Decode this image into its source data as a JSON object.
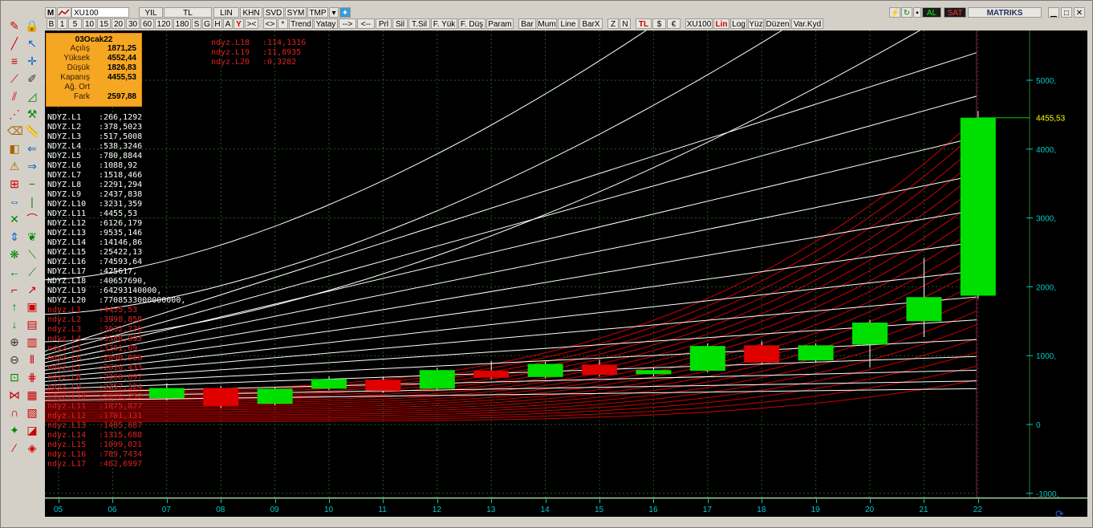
{
  "toolbar_top": {
    "m_label": "M",
    "symbol": "XU100",
    "periods": [
      "YIL",
      "TL",
      "LIN",
      "KHN",
      "SVD",
      "SYM",
      "TMP"
    ],
    "right": {
      "al": "AL",
      "sat": "SAT",
      "brand": "MATRIKS"
    }
  },
  "toolbar_bottom": {
    "buttons": [
      "B",
      "1",
      "5",
      "10",
      "15",
      "20",
      "30",
      "60",
      "120",
      "180",
      "S",
      "G",
      "H",
      "A",
      "Y",
      "><",
      "<>",
      "*",
      "Trend",
      "Yatay",
      "-->",
      "<--",
      "Prl",
      "Sil",
      "T.Sil",
      "F. Yük",
      "F. Düş",
      "Param",
      "Bar",
      "Mum",
      "Line",
      "BarX",
      "Z",
      "N",
      "TL",
      "$",
      "€",
      "XU100",
      "Lin",
      "Log",
      "Yüz",
      "Düzen",
      "Var.Kyd"
    ]
  },
  "infobox": {
    "date": "03Ocak22",
    "rows": [
      {
        "k": "Açılış",
        "v": "1871,25"
      },
      {
        "k": "Yüksek",
        "v": "4552,44"
      },
      {
        "k": "Düşük",
        "v": "1826,83"
      },
      {
        "k": "Kapanış",
        "v": "4455,53"
      },
      {
        "k": "Ağ. Ort",
        "v": ""
      },
      {
        "k": "Fark",
        "v": "2597,88"
      }
    ]
  },
  "top_series": [
    {
      "name": "ndyz.L18",
      "value": ":114,1316"
    },
    {
      "name": "ndyz.L19",
      "value": ":11,8935"
    },
    {
      "name": "ndyz.L20",
      "value": ":0,3282"
    }
  ],
  "white_series": [
    {
      "name": "NDYZ.L1",
      "value": ":266,1292"
    },
    {
      "name": "NDYZ.L2",
      "value": ":378,5023"
    },
    {
      "name": "NDYZ.L3",
      "value": ":517,5008"
    },
    {
      "name": "NDYZ.L4",
      "value": ":538,3246"
    },
    {
      "name": "NDYZ.L5",
      "value": ":780,8844"
    },
    {
      "name": "NDYZ.L6",
      "value": ":1088,92"
    },
    {
      "name": "NDYZ.L7",
      "value": ":1518,466"
    },
    {
      "name": "NDYZ.L8",
      "value": ":2291,294"
    },
    {
      "name": "NDYZ.L9",
      "value": ":2437,838"
    },
    {
      "name": "NDYZ.L10",
      "value": ":3231,359"
    },
    {
      "name": "NDYZ.L11",
      "value": ":4455,53"
    },
    {
      "name": "NDYZ.L12",
      "value": ":6126,179"
    },
    {
      "name": "NDYZ.L13",
      "value": ":9535,146"
    },
    {
      "name": "NDYZ.L14",
      "value": ":14146,86"
    },
    {
      "name": "NDYZ.L15",
      "value": ":25422,13"
    },
    {
      "name": "NDYZ.L16",
      "value": ":74593,64"
    },
    {
      "name": "NDYZ.L17",
      "value": ":425617,"
    },
    {
      "name": "NDYZ.L18",
      "value": ":40657690,"
    },
    {
      "name": "NDYZ.L19",
      "value": ":64293140000,"
    },
    {
      "name": "NDYZ.L20",
      "value": ":7708533000000000,"
    }
  ],
  "red_series": [
    {
      "name": "ndyz.L1",
      "value": ":4455,53"
    },
    {
      "name": "ndyz.L2",
      "value": ":3998,858"
    },
    {
      "name": "ndyz.L3",
      "value": ":3632,726"
    },
    {
      "name": "ndyz.L4",
      "value": ":3588,993"
    },
    {
      "name": "ndyz.L5",
      "value": ":3201,69"
    },
    {
      "name": "ndyz.L6",
      "value": ":2890,986"
    },
    {
      "name": "ndyz.L7",
      "value": ":2610,433"
    },
    {
      "name": "ndyz.L8",
      "value": ":2300,697"
    },
    {
      "name": "ndyz.L9",
      "value": ":2257,324"
    },
    {
      "name": "ndyz.L10",
      "value": ":2070,252"
    },
    {
      "name": "ndyz.L11",
      "value": ":1875,827"
    },
    {
      "name": "ndyz.L12",
      "value": ":1701,131"
    },
    {
      "name": "ndyz.L13",
      "value": ":1485,087"
    },
    {
      "name": "ndyz.L14",
      "value": ":1315,688"
    },
    {
      "name": "ndyz.L15",
      "value": ":1099,021"
    },
    {
      "name": "ndyz.L16",
      "value": ":789,7434"
    },
    {
      "name": "ndyz.L17",
      "value": ":462,6997"
    }
  ],
  "chart_data": {
    "type": "candlestick",
    "x_labels": [
      "05",
      "06",
      "07",
      "08",
      "09",
      "10",
      "11",
      "12",
      "13",
      "14",
      "15",
      "16",
      "17",
      "18",
      "19",
      "20",
      "21",
      "22"
    ],
    "y_ticks": [
      "5000,",
      "4000,",
      "3000,",
      "2000,",
      "1000,",
      "0",
      "-1000,"
    ],
    "y_tick_values": [
      5000,
      4000,
      3000,
      2000,
      1000,
      0,
      -1000
    ],
    "ylim": [
      -1000,
      5600
    ],
    "last_price_label": "4455,53",
    "last_price": 4455.53,
    "candles": [
      {
        "x": "07",
        "open": 380,
        "close": 530,
        "high": 600,
        "low": 350
      },
      {
        "x": "08",
        "open": 530,
        "close": 270,
        "high": 560,
        "low": 240
      },
      {
        "x": "09",
        "open": 300,
        "close": 520,
        "high": 540,
        "low": 280
      },
      {
        "x": "10",
        "open": 520,
        "close": 660,
        "high": 700,
        "low": 500
      },
      {
        "x": "11",
        "open": 650,
        "close": 490,
        "high": 690,
        "low": 460
      },
      {
        "x": "12",
        "open": 520,
        "close": 790,
        "high": 820,
        "low": 500
      },
      {
        "x": "13",
        "open": 780,
        "close": 680,
        "high": 920,
        "low": 660
      },
      {
        "x": "14",
        "open": 690,
        "close": 880,
        "high": 910,
        "low": 670
      },
      {
        "x": "15",
        "open": 870,
        "close": 720,
        "high": 940,
        "low": 700
      },
      {
        "x": "16",
        "open": 730,
        "close": 790,
        "high": 820,
        "low": 700
      },
      {
        "x": "17",
        "open": 780,
        "close": 1140,
        "high": 1180,
        "low": 760
      },
      {
        "x": "18",
        "open": 1150,
        "close": 900,
        "high": 1210,
        "low": 880
      },
      {
        "x": "19",
        "open": 930,
        "close": 1150,
        "high": 1180,
        "low": 900
      },
      {
        "x": "20",
        "open": 1160,
        "close": 1480,
        "high": 1520,
        "low": 830
      },
      {
        "x": "21",
        "open": 1500,
        "close": 1850,
        "high": 2420,
        "low": 1270
      },
      {
        "x": "22",
        "open": 1871.25,
        "close": 4455.53,
        "high": 4552.44,
        "low": 1826.83
      }
    ],
    "up_color": "#00e000",
    "down_color": "#e00000",
    "grid": true,
    "grid_color": "#1f5a1f"
  }
}
